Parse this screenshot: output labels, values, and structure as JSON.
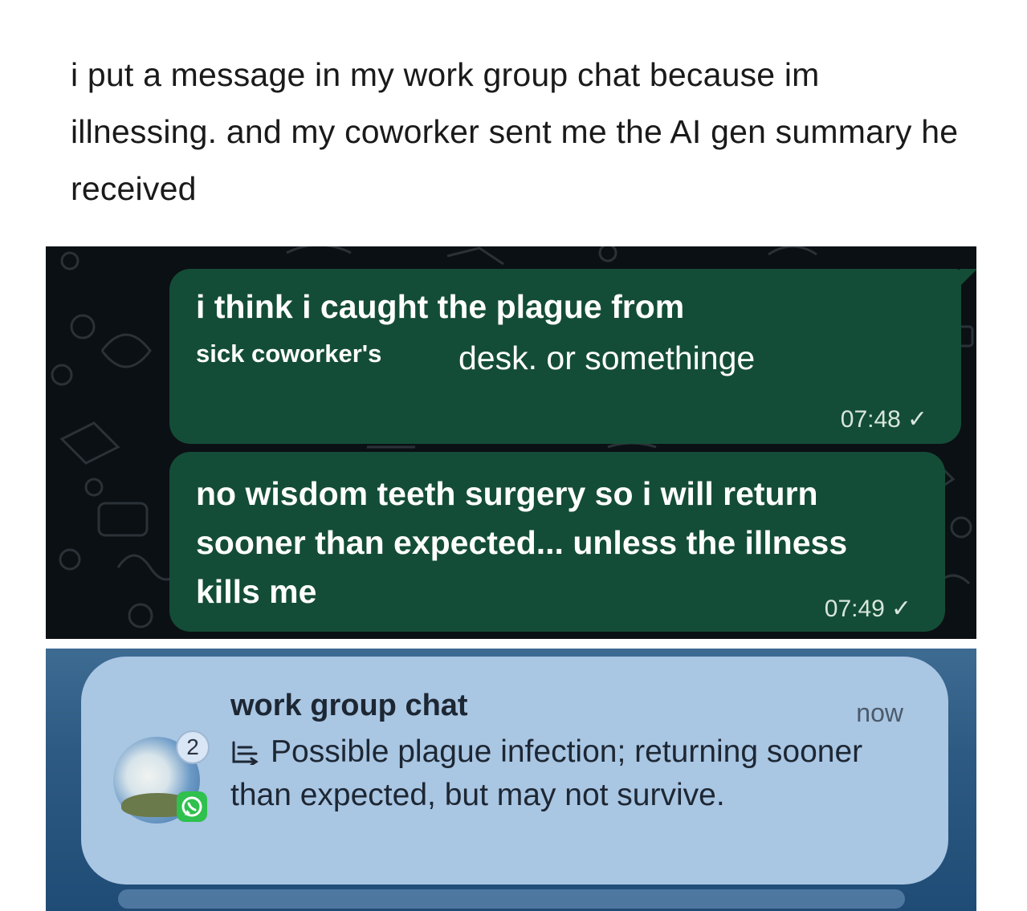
{
  "caption": "i put a message in my work group chat because im illnessing. and my coworker sent me the AI gen summary he received",
  "messages": [
    {
      "line1": "i think i caught the plague from",
      "line2_small": "sick coworker's",
      "line2_rest": "desk. or somethinge",
      "time": "07:48",
      "status": "✓"
    },
    {
      "text": "no wisdom teeth surgery so i will return sooner than expected... unless the illness kills me",
      "time": "07:49",
      "status": "✓"
    }
  ],
  "notification": {
    "title": "work group chat",
    "time": "now",
    "badge_count": "2",
    "summary": "Possible plague infection; returning sooner than expected, but may not survive.",
    "app_icon": "whatsapp-icon",
    "summary_icon": "ai-summary-icon"
  },
  "colors": {
    "chat_background": "#0b1014",
    "bubble": "#144d37",
    "notification_card": "#a9c6e3",
    "whatsapp": "#2fc04e"
  }
}
